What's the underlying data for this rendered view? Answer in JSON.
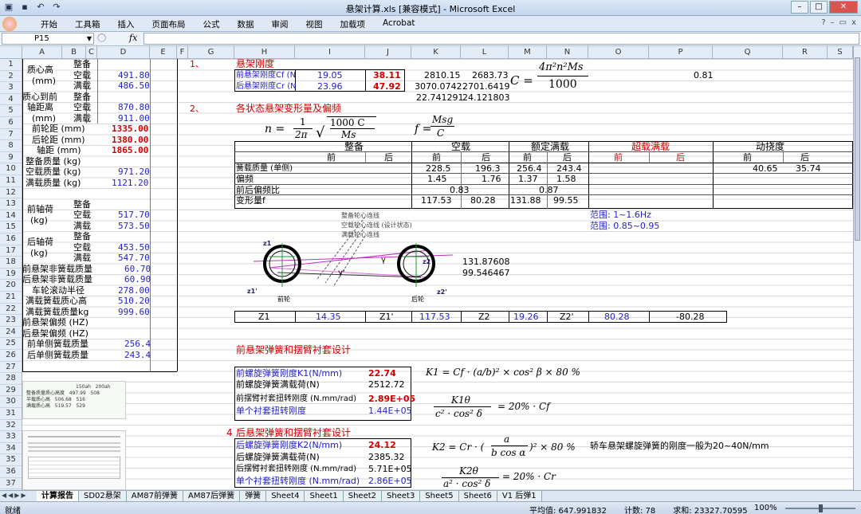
{
  "window": {
    "title": "悬架计算.xls  [兼容模式] - Microsoft Excel"
  },
  "menu": {
    "items": [
      "开始",
      "工具箱",
      "插入",
      "页面布局",
      "公式",
      "数据",
      "审阅",
      "视图",
      "加载项",
      "Acrobat"
    ]
  },
  "formula_bar": {
    "name_box": "P15",
    "fx": "fx",
    "value": ""
  },
  "columns": [
    "A",
    "B",
    "C",
    "D",
    "E",
    "F",
    "G",
    "H",
    "I",
    "J",
    "K",
    "L",
    "M",
    "N",
    "O",
    "P",
    "Q",
    "R",
    "S"
  ],
  "rows": [
    "1",
    "2",
    "3",
    "4",
    "5",
    "6",
    "7",
    "8",
    "9",
    "10",
    "11",
    "12",
    "13",
    "14",
    "15",
    "16",
    "17",
    "18",
    "19",
    "20",
    "21",
    "22",
    "23",
    "24",
    "25",
    "26",
    "27",
    "28",
    "29",
    "30",
    "31",
    "32",
    "33",
    "34",
    "35",
    "36",
    "37"
  ],
  "left": {
    "cg_height": "质心高",
    "cg_unit": "(mm)",
    "curb": "整备",
    "empty": "空载",
    "full": "满载",
    "cg_empty": "491.80",
    "cg_full": "486.50",
    "cg_front": "质心到前",
    "axle_dist": "轴距离",
    "axle_unit": "(mm)",
    "ax_empty": "870.80",
    "ax_full": "911.00",
    "front_track": "前轮距 (mm)",
    "front_track_v": "1335.00",
    "rear_track": "后轮距 (mm)",
    "rear_track_v": "1380.00",
    "wheelbase": "轴距 (mm)",
    "wheelbase_v": "1865.00",
    "curb_mass": "整备质量 (kg)",
    "empty_mass": "空载质量 (kg)",
    "empty_mass_v": "971.20",
    "full_mass": "满载质量 (kg)",
    "full_mass_v": "1121.20",
    "front_axle": "前轴荷",
    "kg": "(kg)",
    "fa_empty": "517.70",
    "fa_full": "573.50",
    "rear_axle": "后轴荷",
    "ra_empty": "453.50",
    "ra_full": "547.70",
    "f_unsprung": "前悬架非簧载质量",
    "f_unsprung_v": "60.70",
    "r_unsprung": "后悬架非簧载质量",
    "r_unsprung_v": "60.90",
    "wheel_r": "车轮滚动半径",
    "wheel_r_v": "278.00",
    "sprung_cg": "满载簧载质心高",
    "sprung_cg_v": "510.20",
    "sprung_mass": "满载簧载质量kg",
    "sprung_mass_v": "999.60",
    "f_freq": "前悬架偏频 (HZ)",
    "r_freq": "后悬架偏频 (HZ)",
    "f_single": "前单侧簧载质量",
    "f_single_v": "256.4",
    "r_single": "后单侧簧载质量",
    "r_single_v": "243.4"
  },
  "sec1": {
    "num": "1、",
    "title": "悬架刚度",
    "front_label": "前悬架刚度Cf (N",
    "front_v1": "19.05",
    "front_v2": "38.11",
    "front_k": "2810.15",
    "front_l": "2683.73",
    "rear_label": "后悬架刚度Cr (N",
    "rear_v1": "23.96",
    "rear_v2": "47.92",
    "rear_k": "3070.0742",
    "rear_l": "2701.6419",
    "row4_k": "22.741291",
    "row4_l": "24.121803",
    "p2": "0.81",
    "formula_c": "C =",
    "formula_num": "4π²n²Ms",
    "formula_den": "1000"
  },
  "sec2": {
    "num": "2、",
    "title": "各状态悬架变形量及偏频",
    "f_n": "n =",
    "f_1": "1",
    "f_2pi": "2π",
    "f_1000c": "1000  C",
    "f_ms": "Ms",
    "f_f": "f =",
    "f_msg": "Msg",
    "f_c": "C",
    "h_curb": "整备",
    "h_empty": "空载",
    "h_rated": "额定满载",
    "h_over": "超载满载",
    "h_dyn": "动挠度",
    "front": "前",
    "rear": "后",
    "r_mass": "簧载质量 (单侧)",
    "m_e_f": "228.5",
    "m_e_r": "196.3",
    "m_r_f": "256.4",
    "m_r_r": "243.4",
    "m_d_f": "40.65",
    "m_d_r": "35.74",
    "r_freq": "偏频",
    "fq_e_f": "1.45",
    "fq_e_r": "1.76",
    "fq_r_f": "1.37",
    "fq_r_r": "1.58",
    "r_ratio": "前后偏频比",
    "ratio_e": "0.83",
    "ratio_r": "0.87",
    "r_def": "变形量f",
    "d_e_f": "117.53",
    "d_e_r": "80.28",
    "d_r_f": "131.88",
    "d_r_r": "99.55",
    "range1": "范围: 1~1.6Hz",
    "range2": "范围: 0.85~0.95"
  },
  "diagram": {
    "l1": "整备轮心连线",
    "l2": "空载轮心连线 (设计状态)",
    "l3": "满载轮心连线",
    "z1": "z1",
    "z1p": "z1'",
    "z2": "z2",
    "z2p": "z2'",
    "gamma": "γ",
    "gammap": "γ'",
    "fw": "前轮",
    "rw": "后轮",
    "v1": "131.87608",
    "v2": "99.546467"
  },
  "zrow": {
    "z1": "Z1",
    "z1_v": "14.35",
    "z1p": "Z1'",
    "z1p_v": "117.53",
    "z2": "Z2",
    "z2_v": "19.26",
    "z2p": "Z2'",
    "z2p_v": "80.28",
    "p": "-80.28"
  },
  "sec3": {
    "title": "前悬架弹簧和摆臂衬套设计",
    "r1": "前螺旋弹簧刚度K1(N/mm)",
    "r1_v": "22.74",
    "r2": "前螺旋弹簧满载荷(N)",
    "r2_v": "2512.72",
    "r3": "前摆臂衬套扭转刚度 (N.mm/rad)",
    "r3_v": "2.89E+05",
    "r4": "单个衬套扭转刚度",
    "r4_v": "1.44E+05",
    "fk1": "K1 = Cf · (a/b)² × cos² β × 80 %",
    "fk_num": "K1θ",
    "fk_den": "c² · cos² δ",
    "fk_rhs": "= 20% · Cf"
  },
  "sec4": {
    "num": "4",
    "title": "后悬架弹簧和摆臂衬套设计",
    "r1": "后螺旋弹簧刚度K2(N/mm)",
    "r1_v": "24.12",
    "r2": "后螺旋弹簧满载荷(N)",
    "r2_v": "2385.32",
    "r3": "后摆臂衬套扭转刚度 (N.mm/rad)",
    "r3_v": "5.71E+05",
    "r4": "单个衬套扭转刚度 (N.mm/rad)",
    "r4_v": "2.86E+05",
    "fk2": "K2 = Cr · (",
    "fk2_a": "a",
    "fk2_b": "b cos α",
    "fk2_tail": ")² × 80 %",
    "fk_num": "K2θ",
    "fk_den": "a² · cos² δ",
    "fk_rhs": "= 20% · Cr",
    "note": "轿车悬架螺旋弹簧的刚度一般为20~40N/mm"
  },
  "thumb": {
    "h1": "150ah",
    "h2": "200ah",
    "r1": "整备质量质心高度",
    "r1a": "497.99",
    "r1b": "508",
    "r2": "半载质心高",
    "r2a": "506.68",
    "r2b": "516",
    "r3": "满载质心高",
    "r3a": "519.57",
    "r3b": "529"
  },
  "sheets": [
    "计算报告",
    "SD02悬架",
    "AM87前弹簧",
    "AM87后弹簧",
    "弹簧",
    "Sheet4",
    "Sheet1",
    "Sheet2",
    "Sheet3",
    "Sheet5",
    "Sheet6",
    "V1 后弹1"
  ],
  "status": {
    "ready": "就绪",
    "avg": "平均值: 647.991832",
    "count": "计数: 78",
    "sum": "求和: 23327.70595",
    "zoom": "100%"
  }
}
